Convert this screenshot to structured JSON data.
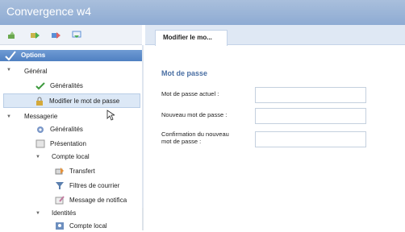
{
  "window": {
    "title": "Convergence w4"
  },
  "toolbar": {
    "icons": [
      "new-icon",
      "forward-icon",
      "export-icon",
      "import-icon"
    ]
  },
  "sidebar": {
    "header": "Options",
    "items": [
      {
        "label": "Général",
        "level": 0,
        "expanded": true
      },
      {
        "label": "Généralités",
        "level": 1,
        "icon": "checkmark-icon"
      },
      {
        "label": "Modifier le mot de passe",
        "level": 1,
        "icon": "lock-icon",
        "selected": true
      },
      {
        "label": "Messagerie",
        "level": 0,
        "expanded": true
      },
      {
        "label": "Généralités",
        "level": 1,
        "icon": "mail-settings-icon"
      },
      {
        "label": "Présentation",
        "level": 1,
        "icon": "presentation-icon"
      },
      {
        "label": "Compte local",
        "level": 1,
        "expanded": true
      },
      {
        "label": "Transfert",
        "level": 2,
        "icon": "forward-mail-icon"
      },
      {
        "label": "Filtres de courrier",
        "level": 2,
        "icon": "filter-icon"
      },
      {
        "label": "Message de notifica",
        "level": 2,
        "icon": "notification-icon"
      },
      {
        "label": "Identités",
        "level": 1,
        "expanded": true
      },
      {
        "label": "Compte local",
        "level": 2,
        "icon": "identity-icon"
      }
    ]
  },
  "main": {
    "tab_label": "Modifier le mo...",
    "section_title": "Mot de passe",
    "fields": [
      {
        "label": "Mot de passe actuel :",
        "value": ""
      },
      {
        "label": "Nouveau mot de passe :",
        "value": ""
      },
      {
        "label_line1": "Confirmation du nouveau",
        "label_line2": "mot de passe :",
        "value": ""
      }
    ]
  }
}
